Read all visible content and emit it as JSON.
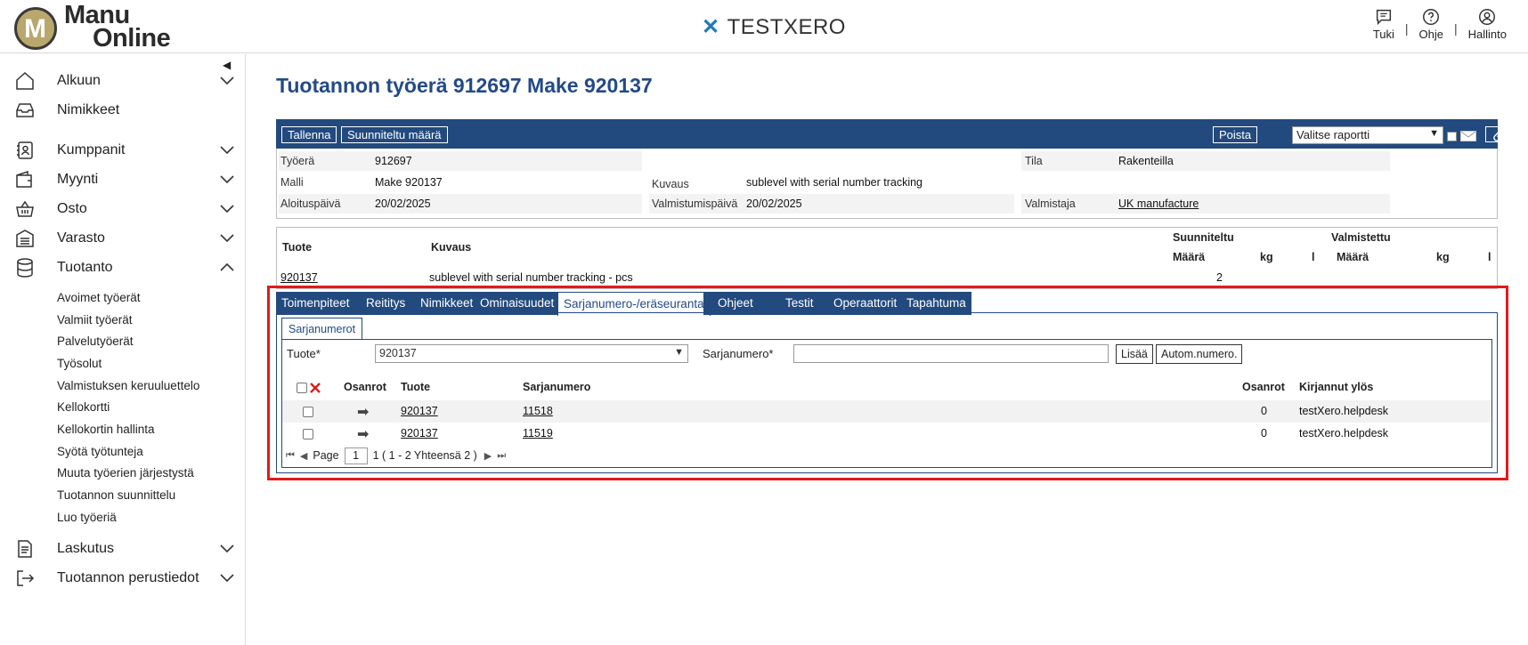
{
  "header": {
    "logo_line1": "Manu",
    "logo_line2": "Online",
    "logo_letter": "M",
    "brand": "TESTXERO",
    "links": [
      {
        "label": "Tuki",
        "icon": "chat-icon"
      },
      {
        "label": "Ohje",
        "icon": "help-icon"
      },
      {
        "label": "Hallinto",
        "icon": "user-icon"
      }
    ],
    "separator": "|"
  },
  "sidebar": {
    "collapse_glyph": "◀",
    "items": [
      {
        "label": "Alkuun",
        "icon": "home-icon",
        "expanded": false
      },
      {
        "label": "Nimikkeet",
        "icon": "inbox-icon"
      },
      {
        "label": "Kumppanit",
        "icon": "contact-icon",
        "expanded": false
      },
      {
        "label": "Myynti",
        "icon": "wallet-icon",
        "expanded": false
      },
      {
        "label": "Osto",
        "icon": "basket-icon",
        "expanded": false
      },
      {
        "label": "Varasto",
        "icon": "warehouse-icon",
        "expanded": false
      },
      {
        "label": "Tuotanto",
        "icon": "database-icon",
        "expanded": true
      },
      {
        "label": "Laskutus",
        "icon": "document-icon",
        "expanded": false
      },
      {
        "label": "Tuotannon perustiedot",
        "icon": "exit-icon",
        "expanded": false
      }
    ],
    "subitems": [
      "Avoimet työerät",
      "Valmiit työerät",
      "Palvelutyöerät",
      "Työsolut",
      "Valmistuksen keruuluettelo",
      "Kellokortti",
      "Kellokortin hallinta",
      "Syötä työtunteja",
      "Muuta työerien järjestystä",
      "Tuotannon suunnittelu",
      "Luo työeriä"
    ]
  },
  "page": {
    "title": "Tuotannon työerä 912697 Make 920137"
  },
  "toolbar": {
    "save_label": "Tallenna",
    "planned_qty_label": "Suunniteltu määrä",
    "delete_label": "Poista",
    "report_select": "Valitse raportti",
    "accent_color": "#234a7e"
  },
  "info": {
    "workorder_label": "Työerä",
    "workorder_value": "912697",
    "status_label": "Tila",
    "status_value": "Rakenteilla",
    "model_label": "Malli",
    "model_value": "Make 920137",
    "desc_label": "Kuvaus",
    "desc_value": "sublevel with serial number tracking",
    "start_label": "Aloituspäivä",
    "start_value": "20/02/2025",
    "finish_label": "Valmistumispäivä",
    "finish_value": "20/02/2025",
    "maker_label": "Valmistaja",
    "maker_value": "UK manufacture"
  },
  "products": {
    "h_product": "Tuote",
    "h_desc": "Kuvaus",
    "h_planned": "Suunniteltu",
    "h_produced": "Valmistettu",
    "h_qty": "Määrä",
    "h_kg": "kg",
    "h_l": "l",
    "row": {
      "product": "920137",
      "desc": "sublevel with serial number tracking - pcs",
      "planned_qty": "2"
    }
  },
  "tabs": {
    "items": [
      "Toimenpiteet",
      "Reititys",
      "Nimikkeet",
      "Ominaisuudet",
      "Sarjanumero-/eräseuranta",
      "Ohjeet",
      "Testit",
      "Operaattorit",
      "Tapahtuma"
    ],
    "active_index": 4,
    "subtab": "Sarjanumerot"
  },
  "serials": {
    "product_label": "Tuote*",
    "product_value": "920137",
    "serial_label": "Sarjanumero*",
    "serial_value": "",
    "add_label": "Lisää",
    "auto_label": "Autom.numero.",
    "columns": [
      "Osanrot",
      "Tuote",
      "Sarjanumero",
      "Osanrot",
      "Kirjannut ylös"
    ],
    "rows": [
      {
        "product": "920137",
        "serial": "11518",
        "parts": "0",
        "user": "testXero.helpdesk"
      },
      {
        "product": "920137",
        "serial": "11519",
        "parts": "0",
        "user": "testXero.helpdesk"
      }
    ],
    "pager": {
      "page_label": "Page",
      "page": "1",
      "summary": "1 ( 1 - 2 Yhteensä 2 )"
    }
  },
  "colors": {
    "highlight": "#e01b1b",
    "title": "#234a87"
  }
}
